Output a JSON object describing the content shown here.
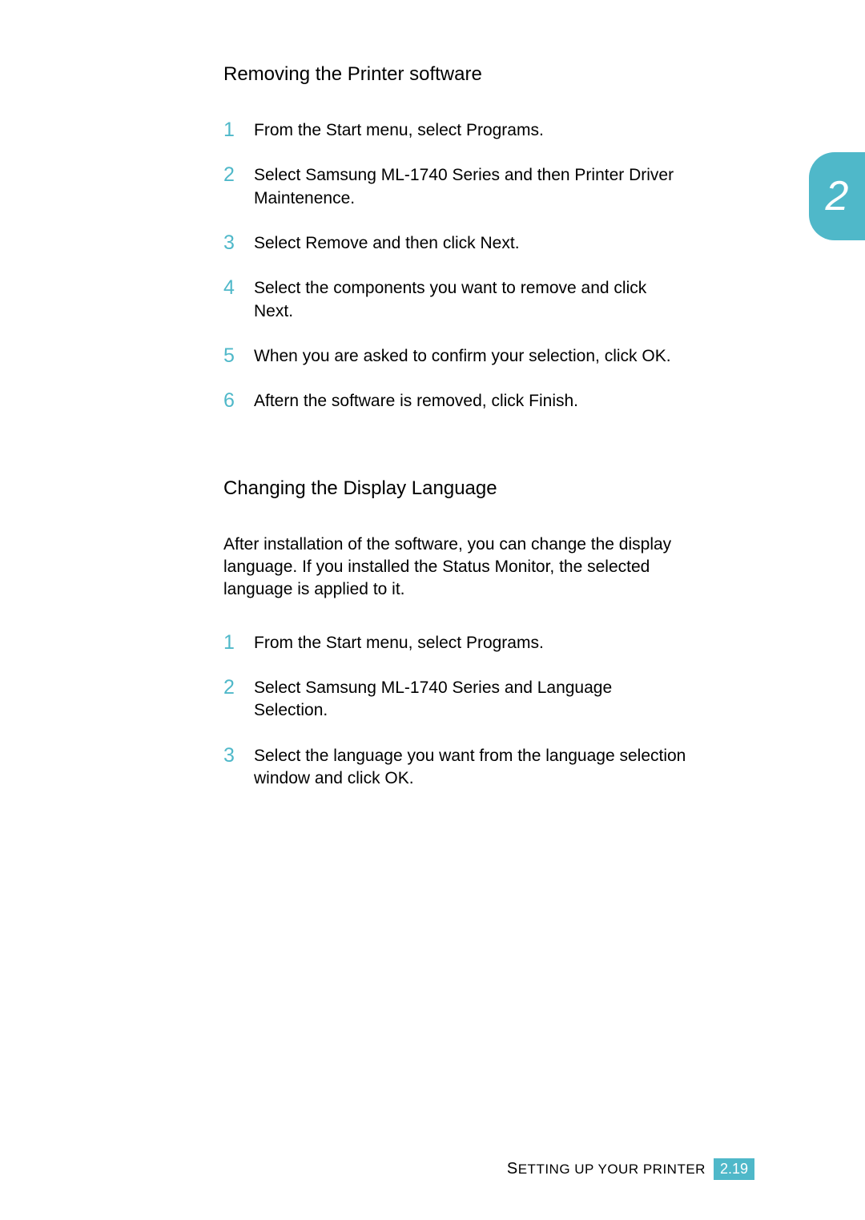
{
  "chapter_tab": "2",
  "section1": {
    "title": "Removing the Printer software",
    "steps": [
      {
        "n": "1",
        "segs": [
          {
            "t": "From the ",
            "b": false
          },
          {
            "t": "Start",
            "b": true
          },
          {
            "t": " menu, select ",
            "b": false
          },
          {
            "t": "Programs",
            "b": true
          },
          {
            "t": ".",
            "b": false
          }
        ]
      },
      {
        "n": "2",
        "segs": [
          {
            "t": "Select ",
            "b": false
          },
          {
            "t": "Samsung ML-1740 Series",
            "b": true
          },
          {
            "t": " and then ",
            "b": false
          },
          {
            "t": "Printer Driver Maintenence",
            "b": true
          },
          {
            "t": ".",
            "b": false
          }
        ]
      },
      {
        "n": "3",
        "segs": [
          {
            "t": "Select ",
            "b": false
          },
          {
            "t": "Remove",
            "b": true
          },
          {
            "t": " and then click ",
            "b": false
          },
          {
            "t": "Next",
            "b": true
          },
          {
            "t": ".",
            "b": false
          }
        ]
      },
      {
        "n": "4",
        "segs": [
          {
            "t": "Select the components you want to remove and click ",
            "b": false
          },
          {
            "t": "Next",
            "b": true
          },
          {
            "t": ".",
            "b": false
          }
        ]
      },
      {
        "n": "5",
        "segs": [
          {
            "t": "When you are asked to confirm your selection, click ",
            "b": false
          },
          {
            "t": "OK",
            "b": true
          },
          {
            "t": ".",
            "b": false
          }
        ]
      },
      {
        "n": "6",
        "segs": [
          {
            "t": "Aftern the software is removed, click ",
            "b": false
          },
          {
            "t": "Finish",
            "b": true
          },
          {
            "t": ".",
            "b": false
          }
        ]
      }
    ]
  },
  "section2": {
    "title": "Changing the Display Language",
    "intro": "After installation of the software, you can change the display language. If you installed the Status Monitor, the selected language is applied to it.",
    "steps": [
      {
        "n": "1",
        "segs": [
          {
            "t": "From the ",
            "b": false
          },
          {
            "t": "Start",
            "b": true
          },
          {
            "t": " menu, select ",
            "b": false
          },
          {
            "t": "Programs",
            "b": true
          },
          {
            "t": ".",
            "b": false
          }
        ]
      },
      {
        "n": "2",
        "segs": [
          {
            "t": "Select ",
            "b": false
          },
          {
            "t": "Samsung ML-1740 Series",
            "b": true
          },
          {
            "t": " and ",
            "b": false
          },
          {
            "t": "Language Selection",
            "b": true
          },
          {
            "t": ".",
            "b": false
          }
        ]
      },
      {
        "n": "3",
        "segs": [
          {
            "t": "Select the language you want from the language selection window and click ",
            "b": false
          },
          {
            "t": "OK",
            "b": true
          },
          {
            "t": ".",
            "b": false
          }
        ]
      }
    ]
  },
  "footer": {
    "label_pre": "S",
    "label_rest": "ETTING UP YOUR PRINTER",
    "page": "2.19"
  }
}
